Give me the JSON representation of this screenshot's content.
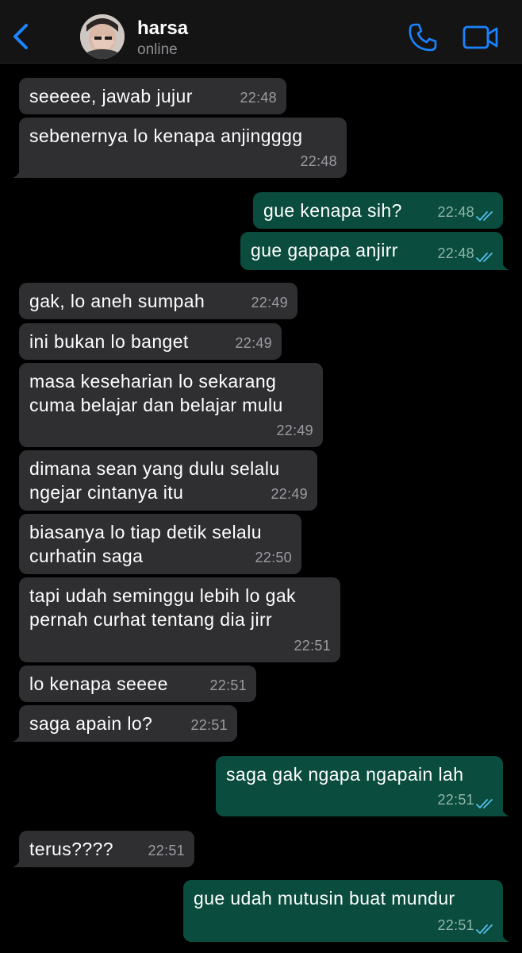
{
  "header": {
    "contact_name": "harsa",
    "status": "online"
  },
  "colors": {
    "accent": "#1a84ff",
    "incoming_bubble": "#2f2f32",
    "outgoing_bubble": "#0a4c3d",
    "read_ticks": "#53bdeb"
  },
  "icons": {
    "back": "chevron-left-icon",
    "call": "phone-icon",
    "video": "video-camera-icon",
    "read": "double-check-icon"
  },
  "messages": [
    {
      "dir": "in",
      "text": "seeeee, jawab jujur",
      "time": "22:48"
    },
    {
      "dir": "in",
      "text": "sebenernya lo kenapa anjingggg",
      "time": "22:48"
    },
    {
      "dir": "out",
      "text": "gue kenapa sih?",
      "time": "22:48"
    },
    {
      "dir": "out",
      "text": "gue gapapa anjirr",
      "time": "22:48"
    },
    {
      "dir": "in",
      "text": "gak, lo aneh sumpah",
      "time": "22:49"
    },
    {
      "dir": "in",
      "text": "ini bukan lo banget",
      "time": "22:49"
    },
    {
      "dir": "in",
      "text": "masa keseharian lo sekarang\ncuma belajar dan belajar mulu",
      "time": "22:49"
    },
    {
      "dir": "in",
      "text": "dimana sean yang dulu selalu\nngejar cintanya itu",
      "time": "22:49"
    },
    {
      "dir": "in",
      "text": "biasanya lo tiap detik selalu\ncurhatin saga",
      "time": "22:50"
    },
    {
      "dir": "in",
      "text": "tapi udah seminggu lebih lo gak\npernah curhat tentang dia jirr",
      "time": "22:51"
    },
    {
      "dir": "in",
      "text": "lo kenapa seeee",
      "time": "22:51"
    },
    {
      "dir": "in",
      "text": "saga apain lo?",
      "time": "22:51"
    },
    {
      "dir": "out",
      "text": "saga gak ngapa ngapain lah",
      "time": "22:51"
    },
    {
      "dir": "in",
      "text": "terus????",
      "time": "22:51"
    },
    {
      "dir": "out",
      "text": "gue udah mutusin buat mundur",
      "time": "22:51"
    }
  ]
}
